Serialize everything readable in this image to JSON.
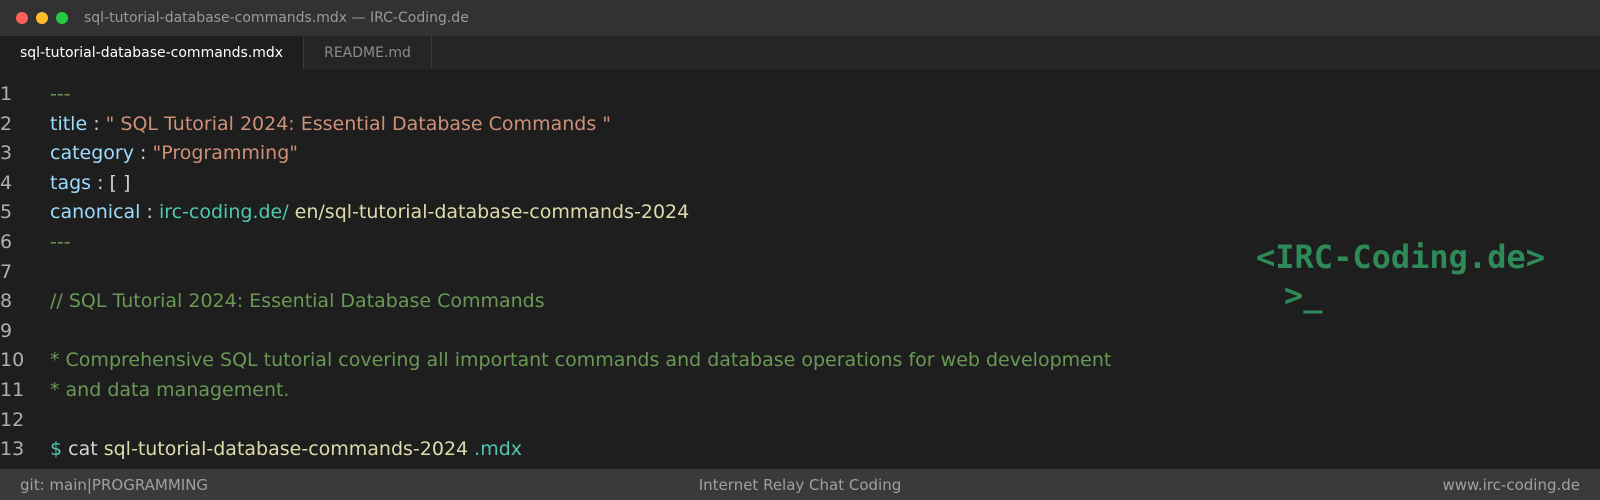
{
  "window": {
    "title": "sql-tutorial-database-commands.mdx — IRC-Coding.de",
    "traffic_lights": [
      "#ff5f57",
      "#febc2e",
      "#28c840"
    ]
  },
  "tabs": [
    {
      "label": "sql-tutorial-database-commands.mdx",
      "active": true
    },
    {
      "label": "README.md",
      "active": false
    }
  ],
  "colors": {
    "key": "#9cdcfe",
    "string": "#ce9178",
    "comment": "#6a9955",
    "accent": "#4ec9b0",
    "path": "#dcdcaa",
    "plain": "#d4d4d4",
    "logo": "#2e8b57"
  },
  "editor": {
    "lines": [
      {
        "n": "1",
        "tokens": [
          {
            "t": "---",
            "c": "comment"
          }
        ]
      },
      {
        "n": "2",
        "tokens": [
          {
            "t": "title",
            "c": "key"
          },
          {
            "t": " : ",
            "c": "plain"
          },
          {
            "t": "\" SQL Tutorial 2024: Essential Database Commands \"",
            "c": "string"
          }
        ]
      },
      {
        "n": "3",
        "tokens": [
          {
            "t": "category",
            "c": "key"
          },
          {
            "t": " : ",
            "c": "plain"
          },
          {
            "t": "\"Programming\"",
            "c": "string"
          }
        ]
      },
      {
        "n": "4",
        "tokens": [
          {
            "t": "tags",
            "c": "key"
          },
          {
            "t": " : [ ]",
            "c": "plain"
          }
        ]
      },
      {
        "n": "5",
        "tokens": [
          {
            "t": "canonical",
            "c": "key"
          },
          {
            "t": " : ",
            "c": "plain"
          },
          {
            "t": "irc-coding.de/",
            "c": "accent"
          },
          {
            "t": " en/sql-tutorial-database-commands-2024",
            "c": "path"
          }
        ]
      },
      {
        "n": "6",
        "tokens": [
          {
            "t": "---",
            "c": "comment"
          }
        ]
      },
      {
        "n": "7",
        "tokens": []
      },
      {
        "n": "8",
        "tokens": [
          {
            "t": "// SQL Tutorial 2024: Essential Database Commands",
            "c": "comment"
          }
        ]
      },
      {
        "n": "9",
        "tokens": []
      },
      {
        "n": "10",
        "tokens": [
          {
            "t": "* Comprehensive SQL tutorial covering all important commands and database operations for web development",
            "c": "comment"
          }
        ]
      },
      {
        "n": "11",
        "tokens": [
          {
            "t": "* and data management.",
            "c": "comment"
          }
        ]
      },
      {
        "n": "12",
        "tokens": []
      },
      {
        "n": "13",
        "tokens": [
          {
            "t": "$",
            "c": "accent"
          },
          {
            "t": " cat ",
            "c": "plain"
          },
          {
            "t": "sql-tutorial-database-commands-2024",
            "c": "path"
          },
          {
            "t": " .mdx",
            "c": "accent"
          }
        ]
      }
    ]
  },
  "logo": {
    "line1": "<IRC-Coding.de>",
    "line2": ">_"
  },
  "statusbar": {
    "left": "git: main|PROGRAMMING",
    "center": "Internet Relay Chat Coding",
    "right": "www.irc-coding.de"
  }
}
